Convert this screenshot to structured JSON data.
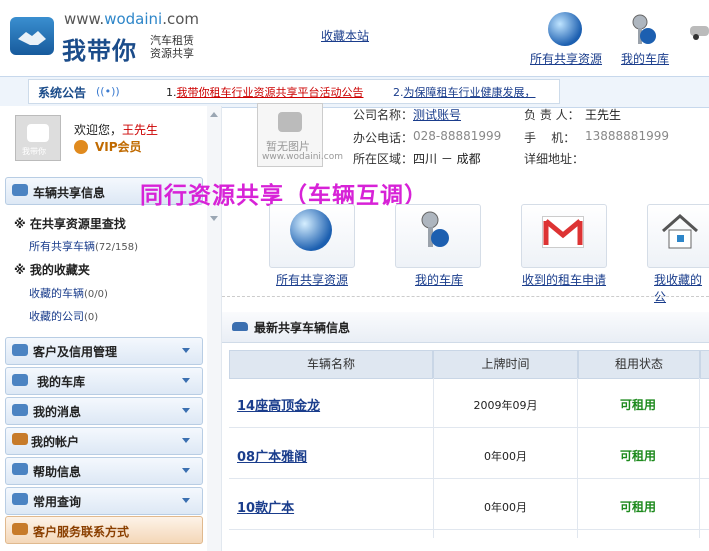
{
  "header": {
    "logo_url_prefix": "www.",
    "logo_url_domain": "wodaini",
    "logo_url_suffix": ".com",
    "logo_name": "我带你",
    "logo_sub1": "汽车租赁",
    "logo_sub2": "资源共享",
    "favorite_link": "收藏本站",
    "nav": [
      {
        "label": "所有共享资源",
        "icon": "globe-icon"
      },
      {
        "label": "我的车库",
        "icon": "car-keys-icon"
      }
    ]
  },
  "notice": {
    "title": "系统公告",
    "item1_no": "1.",
    "item1": "我带你租车行业资源共享平台活动公告",
    "item2_no": "2.",
    "item2": "为保障租车行业健康发展，"
  },
  "user": {
    "avatar_text": "我带你",
    "welcome": "欢迎您，",
    "name": "王先生",
    "level": "VIP会员"
  },
  "sidebar": {
    "vehicle_share": "车辆共享信息",
    "search_head": "在共享资源里查找",
    "all_shared": "所有共享车辆",
    "all_shared_count": "(72/158)",
    "favorites_head": "我的收藏夹",
    "fav_cars": "收藏的车辆",
    "fav_cars_count": "(0/0)",
    "fav_companies": "收藏的公司",
    "fav_companies_count": "(0)",
    "sections": [
      {
        "label": "客户及信用管理"
      },
      {
        "label": "我的车库"
      },
      {
        "label": "我的消息"
      },
      {
        "label": "我的帐户"
      },
      {
        "label": "帮助信息"
      },
      {
        "label": "常用查询"
      }
    ],
    "customer_service": "客户服务联系方式"
  },
  "company": {
    "no_image_line1": "暂无图片",
    "no_image_line2": "www.wodaini.com",
    "name_label": "公司名称：",
    "name_value": "测试账号",
    "phone_label": "办公电话：",
    "phone_value": "028-88881999",
    "region_label": "所在区域：",
    "region_value": "四川 － 成都",
    "contact_label": "负 责 人：",
    "contact_value": "王先生",
    "mobile_label": "手    机：",
    "mobile_value": "13888881999",
    "address_label": "详细地址："
  },
  "banner": "同行资源共享（车辆互调）",
  "quick": [
    {
      "label": "所有共享资源",
      "icon": "globe-icon"
    },
    {
      "label": "我的车库",
      "icon": "car-keys-icon"
    },
    {
      "label": "收到的租车申请",
      "icon": "gmail-icon"
    },
    {
      "label": "我收藏的公",
      "icon": "house-icon"
    }
  ],
  "table": {
    "title": "最新共享车辆信息",
    "headers": [
      "车辆名称",
      "上牌时间",
      "租用状态"
    ],
    "rows": [
      {
        "name": "14座高顶金龙",
        "date": "2009年09月",
        "status": "可租用"
      },
      {
        "name": "08广本雅阁",
        "date": "0年00月",
        "status": "可租用"
      },
      {
        "name": "10款广本",
        "date": "0年00月",
        "status": "可租用"
      }
    ]
  },
  "colors": {
    "brand_blue": "#1b4c8a",
    "banner_magenta": "#d722d7",
    "status_green": "#1d8a1d",
    "notice_red": "#cc0000"
  }
}
